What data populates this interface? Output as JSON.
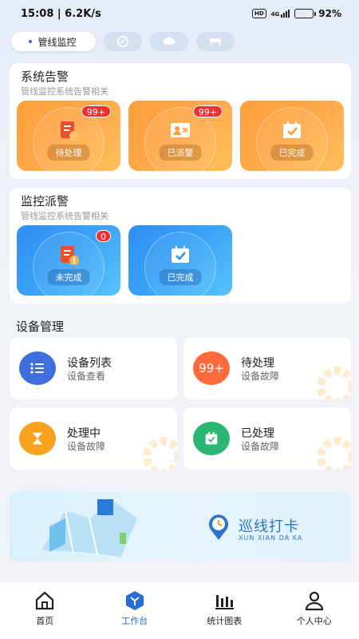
{
  "status_bar": {
    "time_speed": "15:08 | 6.2K/s",
    "network": "HD",
    "signal": "4G",
    "battery": "92%"
  },
  "top_tabs": {
    "active_label": "管线监控",
    "icons": [
      "gauge-icon",
      "cloud-icon",
      "barrier-icon"
    ]
  },
  "system_alarm": {
    "title": "系统告警",
    "subtitle": "管线监控系统告警相关",
    "tiles": [
      {
        "label": "待处理",
        "badge": "99+",
        "icon": "clipboard-warning-icon"
      },
      {
        "label": "已派警",
        "badge": "99+",
        "icon": "person-dispatch-icon"
      },
      {
        "label": "已完成",
        "badge": "",
        "icon": "calendar-check-icon"
      }
    ]
  },
  "monitor_dispatch": {
    "title": "监控派警",
    "subtitle": "管线监控系统告警相关",
    "tiles": [
      {
        "label": "未完成",
        "badge": "0",
        "icon": "clipboard-warning-icon"
      },
      {
        "label": "已完成",
        "badge": "",
        "icon": "calendar-check-icon"
      }
    ]
  },
  "device_management": {
    "title": "设备管理",
    "items": [
      {
        "title": "设备列表",
        "sub": "设备查看",
        "icon": "list-icon",
        "color": "#3f6fdc"
      },
      {
        "title": "待处理",
        "sub": "设备故障",
        "icon_text": "99+",
        "color": "#ff6a3d"
      },
      {
        "title": "处理中",
        "sub": "设备故障",
        "icon": "hourglass-icon",
        "color": "#f7a21f"
      },
      {
        "title": "已处理",
        "sub": "设备故障",
        "icon": "calendar-check-icon",
        "color": "#2bb673"
      }
    ]
  },
  "banner": {
    "title": "巡线打卡",
    "subtitle": "XUN XIAN DA KA"
  },
  "bottom_nav": {
    "items": [
      {
        "label": "首页",
        "icon": "home-icon"
      },
      {
        "label": "工作台",
        "icon": "workbench-icon",
        "active": true
      },
      {
        "label": "统计图表",
        "icon": "bar-chart-icon"
      },
      {
        "label": "个人中心",
        "icon": "user-icon"
      }
    ]
  },
  "colors": {
    "accent": "#2a6ad6",
    "orange": "#ff9d3a",
    "blue": "#2f8ef4",
    "badge": "#f0302e"
  }
}
